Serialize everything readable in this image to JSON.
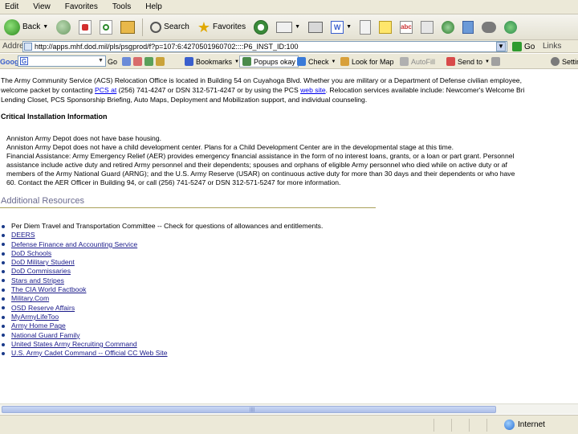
{
  "menu": [
    "Edit",
    "View",
    "Favorites",
    "Tools",
    "Help"
  ],
  "toolbar": {
    "back_label": "Back",
    "search_label": "Search",
    "favorites_label": "Favorites"
  },
  "address": {
    "label": "Address",
    "url": "http://apps.mhf.dod.mil/pls/psgprod/f?p=107:6:4270501960702::::P6_INST_ID:100",
    "go_label": "Go",
    "links_label": "Links"
  },
  "google_toolbar": {
    "logo": "Google",
    "go_label": "Go",
    "bookmarks_label": "Bookmarks",
    "popups_label": "Popups okay",
    "check_label": "Check",
    "lookup_label": "Look for Map",
    "autofill_label": "AutoFill",
    "send_label": "Send to",
    "settings_label": "Settings"
  },
  "content": {
    "intro_line1": "The Army Community Service (ACS) Relocation Office is located in Building 54 on Cuyahoga Blvd. Whether you are military or a Department of Defense civilian employee,",
    "intro_line2a": "welcome packet by contacting ",
    "intro_line2_link1": "PCS at",
    "intro_line2b": " (256) 741-4247 or DSN 312-571-4247 or by using the PCS ",
    "intro_line2_link2": "web site",
    "intro_line2c": ". Relocation services available include: Newcomer's Welcome Bri",
    "intro_line3": "Lending Closet, PCS Sponsorship Briefing, Auto Maps, Deployment and Mobilization support, and individual counseling.",
    "critical_heading": "Critical Installation Information",
    "crit_line1": "Anniston Army Depot does not have base housing.",
    "crit_line2": "Anniston Army Depot does not have a child development center. Plans for a Child Development Center are in the developmental stage at this time.",
    "crit_line3": "Financial Assistance: Army Emergency Relief (AER) provides emergency financial assistance in the form of no interest loans, grants, or a loan or part grant. Personnel",
    "crit_line4": "assistance include active duty and retired Army personnel and their dependents; spouses and orphans of eligible Army personnel who died while on active duty or af",
    "crit_line5": "members of the Army National Guard (ARNG); and the U.S. Army Reserve (USAR) on continuous active duty for more than 30 days and their dependents or who have",
    "crit_line6": "60. Contact the AER Officer in Building 94, or call (256) 741-5247 or DSN 312-571-5247 for more information.",
    "additional_resources_title": "Additional Resources",
    "resources": [
      {
        "label": "Per Diem Travel and Transportation Committee -- Check for questions of allowances and entitlements.",
        "linked": false
      },
      {
        "label": "DEERS",
        "linked": true
      },
      {
        "label": "Defense Finance and Accounting Service",
        "linked": true
      },
      {
        "label": "DoD Schools",
        "linked": true
      },
      {
        "label": "DoD Military Student",
        "linked": true
      },
      {
        "label": "DoD Commissaries",
        "linked": true
      },
      {
        "label": "Stars and Stripes",
        "linked": true
      },
      {
        "label": "The CIA World Factbook",
        "linked": true
      },
      {
        "label": "Military.Com",
        "linked": true
      },
      {
        "label": "OSD Reserve Affairs",
        "linked": true
      },
      {
        "label": "MyArmyLifeToo",
        "linked": true
      },
      {
        "label": "Army Home Page",
        "linked": true
      },
      {
        "label": "National Guard Family",
        "linked": true
      },
      {
        "label": "United States Army Recruiting Command",
        "linked": true
      },
      {
        "label": "U.S. Army Cadet Command -- Official CC Web Site",
        "linked": true
      }
    ]
  },
  "status": {
    "zone_label": "Internet"
  },
  "colors": {
    "chrome": "#ece9d8",
    "link": "#0000ee",
    "resource_link": "#1a1a8a",
    "section_title": "#6b6b8f",
    "rule": "#a9a15a"
  }
}
